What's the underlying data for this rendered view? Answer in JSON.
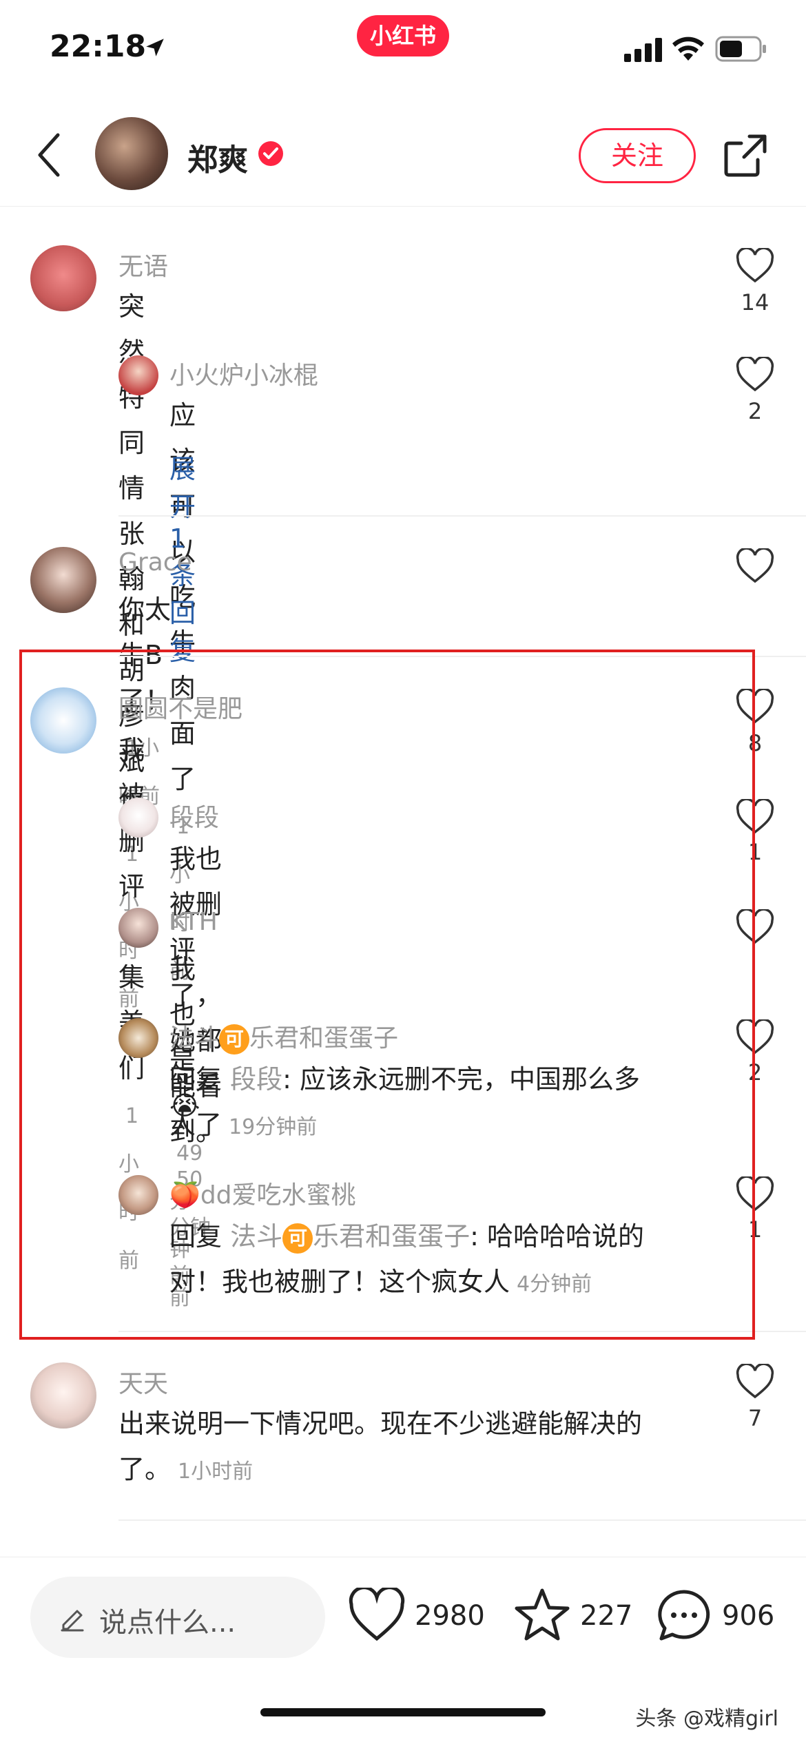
{
  "status_bar": {
    "time": "22:18",
    "brand": "小红书"
  },
  "header": {
    "author_name": "郑爽",
    "follow_label": "关注"
  },
  "comments": [
    {
      "user": "无语",
      "text": "突然特同情张翰和胡彦斌了",
      "time": "1小时前",
      "likes": "14",
      "replies": [
        {
          "user": "小火炉小冰棍",
          "text": "应该可以吃牛肉面了",
          "time": "1小时前",
          "likes": "2"
        }
      ],
      "expand_label": "展开 1 条回复"
    },
    {
      "user": "Grace",
      "text": "你太牛B了！",
      "time": "1小时前",
      "likes": ""
    },
    {
      "user": "圆圆不是肥",
      "text": "我被删评了集美们",
      "time": "1小时前",
      "likes": "8",
      "replies": [
        {
          "user": "段段",
          "text": "我也被删评了，她都能看到。",
          "time": "50分钟前",
          "likes": "1"
        },
        {
          "user": "KTH",
          "text": "我也是",
          "emoji": "😭",
          "time": "49分钟前",
          "likes": ""
        },
        {
          "user_prefix": "法斗",
          "user_badge": "可",
          "user_suffix": "乐君和蛋蛋子",
          "reply_prefix": "回复",
          "reply_to": "段段",
          "text_line1": ": 应该永远删不完，中国那么多",
          "text_line2": "人了",
          "time": "19分钟前",
          "likes": "2"
        },
        {
          "user_emoji": "🍑",
          "user": "dd爱吃水蜜桃",
          "reply_prefix": "回复",
          "reply_to_prefix": "法斗",
          "reply_to_badge": "可",
          "reply_to_suffix": "乐君和蛋蛋子",
          "text_line1": ": 哈哈哈哈说的",
          "text_line2": "对！我也被删了！这个疯女人",
          "time": "4分钟前",
          "likes": "1"
        }
      ]
    },
    {
      "user": "天天",
      "text_line1": "出来说明一下情况吧。现在不少逃避能解决的",
      "text_line2": "了。",
      "time": "1小时前",
      "likes": "7"
    }
  ],
  "bottom_bar": {
    "input_placeholder": "说点什么...",
    "like_count": "2980",
    "star_count": "227",
    "comment_count": "906"
  },
  "watermark": "头条 @戏精girl",
  "colors": {
    "brand_red": "#ff2442",
    "link_blue": "#2a5fa8",
    "highlight_red": "#e02020"
  }
}
